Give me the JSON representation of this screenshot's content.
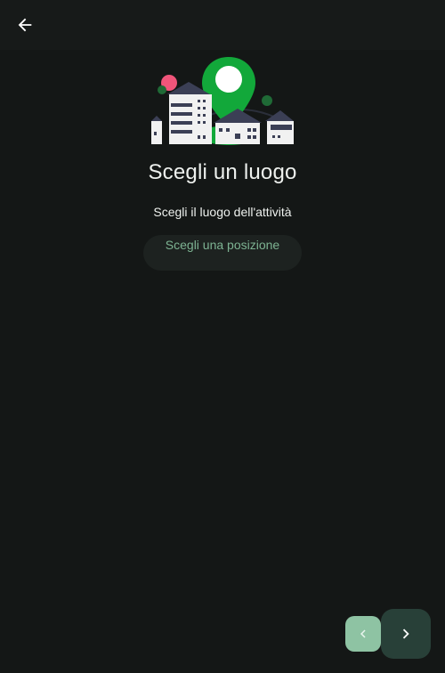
{
  "header": {
    "back_icon": "arrow-left-icon"
  },
  "hero": {
    "illustration": "location-pin-buildings-illustration",
    "colors": {
      "pin": "#12a83a",
      "dot": "#f0557a",
      "buildings": "#3b3f55"
    }
  },
  "main": {
    "title": "Scegli un luogo",
    "subtitle": "Scegli il luogo dell'attività",
    "choose_location_label": "Scegli una posizione"
  },
  "navigation": {
    "prev_icon": "chevron-left-icon",
    "next_icon": "chevron-right-icon"
  },
  "colors": {
    "background": "#141716",
    "accent": "#7db392",
    "prev_button": "#8ec3a3",
    "next_button": "#284038"
  }
}
